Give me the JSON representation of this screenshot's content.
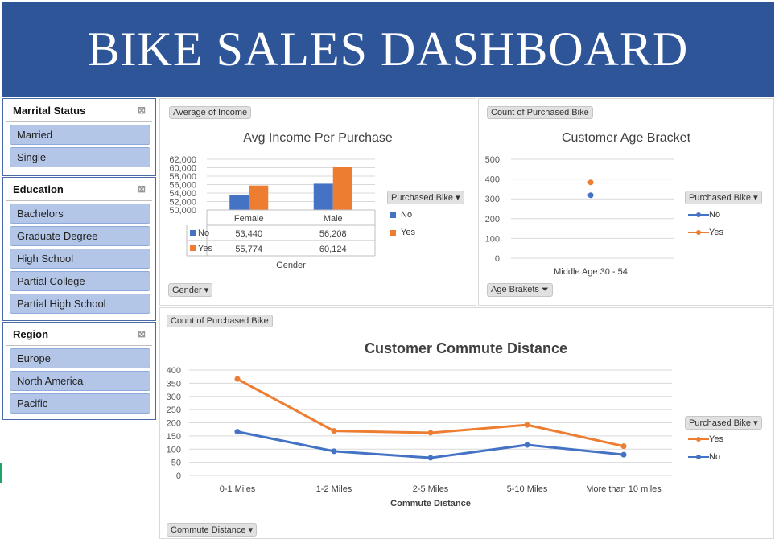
{
  "header": {
    "title": "BIKE SALES DASHBOARD"
  },
  "colors": {
    "banner": "#2e5597",
    "no": "#4472c4",
    "yes": "#ed7d31",
    "slicer_item": "#b4c6e7"
  },
  "slicers": [
    {
      "title": "Marrital Status",
      "items": [
        "Married",
        "Single"
      ]
    },
    {
      "title": "Education",
      "items": [
        "Bachelors",
        "Graduate Degree",
        "High School",
        "Partial College",
        "Partial High School"
      ]
    },
    {
      "title": "Region",
      "items": [
        "Europe",
        "North America",
        "Pacific"
      ]
    }
  ],
  "income_chart": {
    "value_button": "Average of Income",
    "axis_button": "Gender",
    "legend_button": "Purchased Bike",
    "legend": [
      "No",
      "Yes"
    ],
    "xlabel": "Gender",
    "table_headers": [
      "Female",
      "Male"
    ],
    "table_rows": [
      {
        "label": "No",
        "values": [
          "53,440",
          "56,208"
        ]
      },
      {
        "label": "Yes",
        "values": [
          "55,774",
          "60,124"
        ]
      }
    ]
  },
  "age_chart": {
    "value_button": "Count of Purchased Bike",
    "axis_button": "Age Brakets",
    "legend_button": "Purchased Bike",
    "legend": [
      "No",
      "Yes"
    ]
  },
  "commute_chart": {
    "value_button": "Count of Purchased Bike",
    "axis_button": "Commute Distance",
    "legend_button": "Purchased Bike",
    "legend": [
      "Yes",
      "No"
    ]
  },
  "chart_data": [
    {
      "type": "bar",
      "title": "Avg Income Per Purchase",
      "categories": [
        "Female",
        "Male"
      ],
      "series": [
        {
          "name": "No",
          "values": [
            53440,
            56208
          ]
        },
        {
          "name": "Yes",
          "values": [
            55774,
            60124
          ]
        }
      ],
      "xlabel": "Gender",
      "ylabel": "",
      "ylim": [
        50000,
        62000
      ],
      "yticks": [
        "62,000",
        "60,000",
        "58,000",
        "56,000",
        "54,000",
        "52,000",
        "50,000"
      ],
      "grid": true,
      "legend_position": "right"
    },
    {
      "type": "scatter",
      "title": "Customer Age Bracket",
      "categories": [
        "Middle Age 30 - 54"
      ],
      "series": [
        {
          "name": "No",
          "values": [
            318
          ]
        },
        {
          "name": "Yes",
          "values": [
            383
          ]
        }
      ],
      "ylim": [
        0,
        500
      ],
      "yticks": [
        "500",
        "400",
        "300",
        "200",
        "100",
        "0"
      ],
      "grid": true,
      "legend_position": "right"
    },
    {
      "type": "line",
      "title": "Customer Commute Distance",
      "categories": [
        "0-1 Miles",
        "1-2 Miles",
        "2-5 Miles",
        "5-10 Miles",
        "More than 10 miles"
      ],
      "series": [
        {
          "name": "Yes",
          "values": [
            366,
            169,
            162,
            192,
            111
          ]
        },
        {
          "name": "No",
          "values": [
            166,
            92,
            67,
            116,
            79
          ]
        }
      ],
      "xlabel": "Commute Distance",
      "ylim": [
        0,
        400
      ],
      "yticks": [
        "400",
        "350",
        "300",
        "250",
        "200",
        "150",
        "100",
        "50",
        "0"
      ],
      "grid": true,
      "legend_position": "right"
    }
  ]
}
